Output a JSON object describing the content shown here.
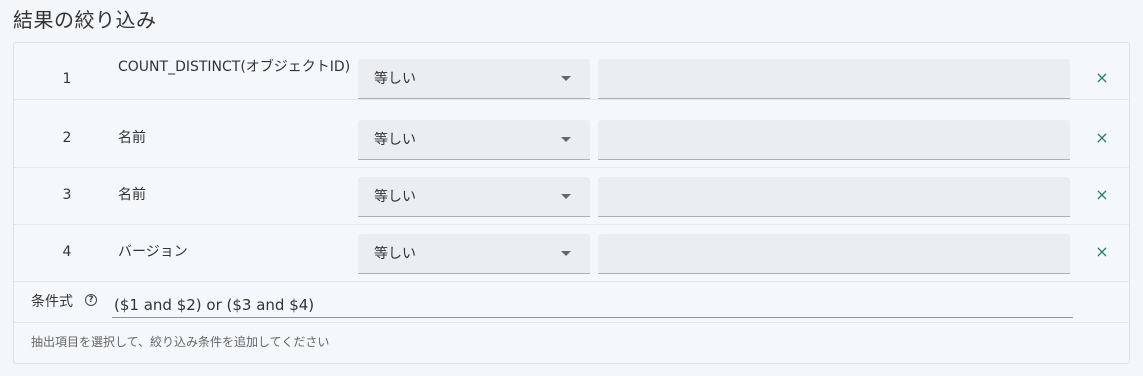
{
  "title": "結果の絞り込み",
  "rows": [
    {
      "index": "1",
      "field": "COUNT_DISTINCT(オブジェクトID)",
      "operator": "等しい",
      "value": ""
    },
    {
      "index": "2",
      "field": "名前",
      "operator": "等しい",
      "value": ""
    },
    {
      "index": "3",
      "field": "名前",
      "operator": "等しい",
      "value": ""
    },
    {
      "index": "4",
      "field": "バージョン",
      "operator": "等しい",
      "value": ""
    }
  ],
  "delete_glyph": "×",
  "condition": {
    "label": "条件式",
    "help_glyph": "?",
    "value": "($1 and $2) or ($3 and $4)"
  },
  "hint": "抽出項目を選択して、絞り込み条件を追加してください",
  "colors": {
    "accent": "#2a7d74",
    "field_bg": "#ebeef1",
    "panel_bg": "#f4f8fb"
  }
}
